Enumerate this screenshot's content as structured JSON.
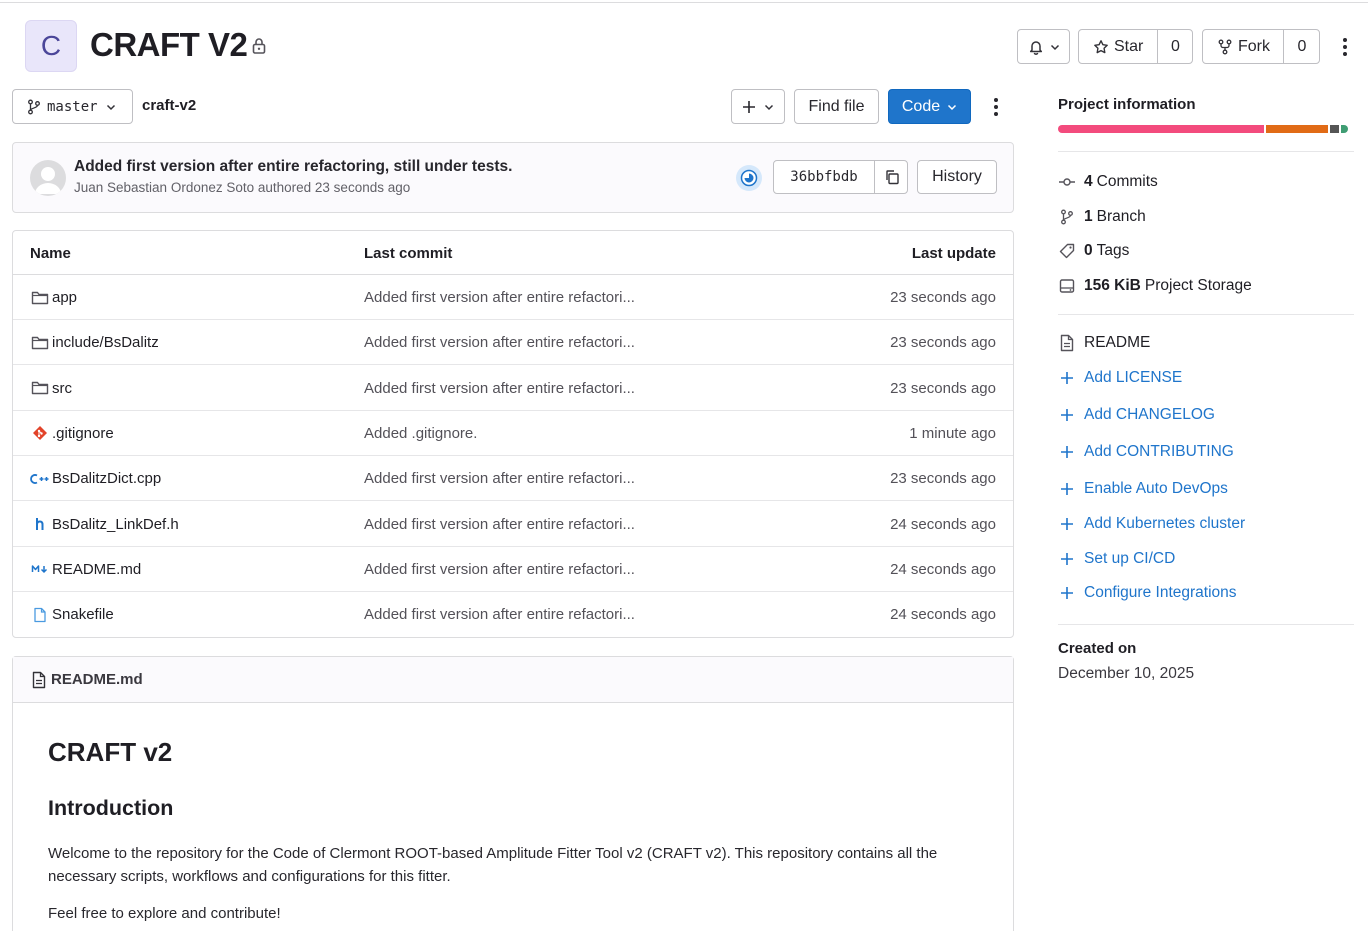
{
  "project": {
    "avatar_letter": "C",
    "title": "CRAFT V2"
  },
  "header_actions": {
    "star_label": "Star",
    "star_count": "0",
    "fork_label": "Fork",
    "fork_count": "0"
  },
  "toolbar": {
    "branch": "master",
    "breadcrumb": "craft-v2",
    "find_file": "Find file",
    "code": "Code"
  },
  "last_commit": {
    "message": "Added first version after entire refactoring, still under tests.",
    "author_line": "Juan Sebastian Ordonez Soto authored 23 seconds ago",
    "sha": "36bbfbdb",
    "history": "History"
  },
  "files": {
    "headers": {
      "name": "Name",
      "commit": "Last commit",
      "update": "Last update"
    },
    "rows": [
      {
        "name": "app",
        "commit": "Added first version after entire refactori...",
        "time": "23 seconds ago",
        "icon": "folder-icon"
      },
      {
        "name": "include/BsDalitz",
        "commit": "Added first version after entire refactori...",
        "time": "23 seconds ago",
        "icon": "folder-icon"
      },
      {
        "name": "src",
        "commit": "Added first version after entire refactori...",
        "time": "23 seconds ago",
        "icon": "folder-icon"
      },
      {
        "name": ".gitignore",
        "commit": "Added .gitignore.",
        "time": "1 minute ago",
        "icon": "git-icon"
      },
      {
        "name": "BsDalitzDict.cpp",
        "commit": "Added first version after entire refactori...",
        "time": "23 seconds ago",
        "icon": "cpp-icon"
      },
      {
        "name": "BsDalitz_LinkDef.h",
        "commit": "Added first version after entire refactori...",
        "time": "24 seconds ago",
        "icon": "header-file-icon"
      },
      {
        "name": "README.md",
        "commit": "Added first version after entire refactori...",
        "time": "24 seconds ago",
        "icon": "markdown-icon"
      },
      {
        "name": "Snakefile",
        "commit": "Added first version after entire refactori...",
        "time": "24 seconds ago",
        "icon": "file-icon"
      }
    ]
  },
  "readme": {
    "file_label": "README.md",
    "h1": "CRAFT v2",
    "h2": "Introduction",
    "p1": "Welcome to the repository for the Code of Clermont ROOT-based Amplitude Fitter Tool v2 (CRAFT v2). This repository contains all the necessary scripts, workflows and configurations for this fitter.",
    "p2": "Feel free to explore and contribute!"
  },
  "sidebar": {
    "heading": "Project information",
    "language_bar": [
      {
        "fraction": 0.71,
        "color": "#f34b7d"
      },
      {
        "fraction": 0.215,
        "color": "#e16b16"
      },
      {
        "fraction": 0.03,
        "color": "#555555"
      },
      {
        "fraction": 0.025,
        "color": "#3f9d73"
      }
    ],
    "stats": [
      {
        "count": "4",
        "label": "Commits",
        "icon": "commit-icon"
      },
      {
        "count": "1",
        "label": "Branch",
        "icon": "branch-icon"
      },
      {
        "count": "0",
        "label": "Tags",
        "icon": "tag-icon"
      },
      {
        "count": "156 KiB",
        "label": "Project Storage",
        "icon": "storage-icon"
      }
    ],
    "readme_link": "README",
    "actions": [
      "Add LICENSE",
      "Add CHANGELOG",
      "Add CONTRIBUTING",
      "Enable Auto DevOps",
      "Add Kubernetes cluster",
      "Set up CI/CD",
      "Configure Integrations"
    ],
    "created_label": "Created on",
    "created_date": "December 10, 2025"
  }
}
